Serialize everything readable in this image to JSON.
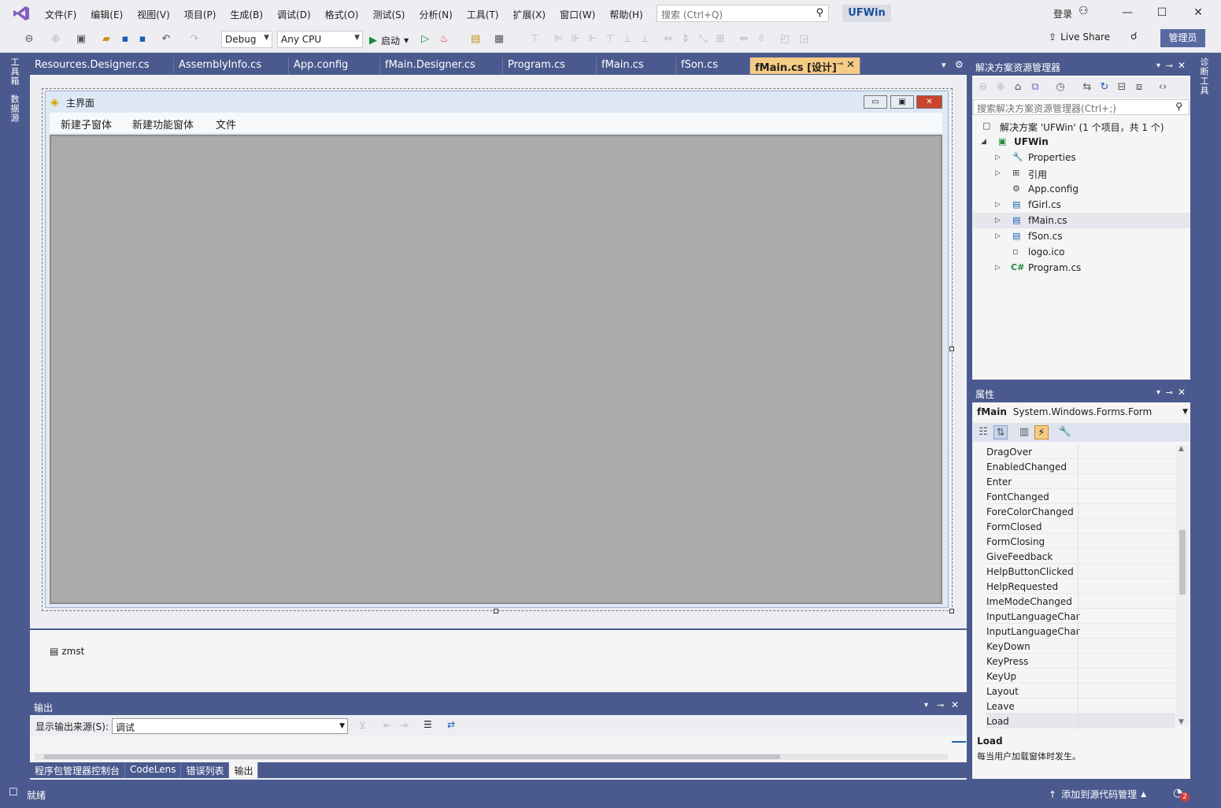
{
  "menu": [
    "文件(F)",
    "编辑(E)",
    "视图(V)",
    "项目(P)",
    "生成(B)",
    "调试(D)",
    "格式(O)",
    "测试(S)",
    "分析(N)",
    "工具(T)",
    "扩展(X)",
    "窗口(W)",
    "帮助(H)"
  ],
  "search": {
    "placeholder": "搜索 (Ctrl+Q)"
  },
  "solution_name": "UFWin",
  "signin": "登录",
  "toolbar": {
    "config": "Debug",
    "platform": "Any CPU",
    "start": "启动"
  },
  "live_share": "Live Share",
  "admin": "管理员",
  "left_tabs": [
    "工具箱",
    "数据源"
  ],
  "right_tabs": [
    "诊断工具"
  ],
  "doc_tabs": [
    "Resources.Designer.cs",
    "AssemblyInfo.cs",
    "App.config",
    "fMain.Designer.cs",
    "Program.cs",
    "fMain.cs",
    "fSon.cs",
    "fMain.cs [设计]"
  ],
  "form": {
    "title": "主界面",
    "menu": [
      "新建子窗体",
      "新建功能窗体",
      "文件"
    ]
  },
  "tray_item": "zmst",
  "output": {
    "title": "输出",
    "source_label": "显示输出来源(S):",
    "source_value": "调试",
    "tabs": [
      "程序包管理器控制台",
      "CodeLens",
      "错误列表",
      "输出"
    ]
  },
  "solexp": {
    "title": "解决方案资源管理器",
    "search_placeholder": "搜索解决方案资源管理器(Ctrl+;)",
    "items": [
      {
        "label": "解决方案 'UFWin' (1 个项目，共 1 个)"
      },
      {
        "label": "UFWin"
      },
      {
        "label": "Properties"
      },
      {
        "label": "引用"
      },
      {
        "label": "App.config"
      },
      {
        "label": "fGirl.cs"
      },
      {
        "label": "fMain.cs"
      },
      {
        "label": "fSon.cs"
      },
      {
        "label": "logo.ico"
      },
      {
        "label": "Program.cs"
      }
    ]
  },
  "props": {
    "title": "属性",
    "object_name": "fMain",
    "object_type": "System.Windows.Forms.Form",
    "events": [
      "DragOver",
      "EnabledChanged",
      "Enter",
      "FontChanged",
      "ForeColorChanged",
      "FormClosed",
      "FormClosing",
      "GiveFeedback",
      "HelpButtonClicked",
      "HelpRequested",
      "ImeModeChanged",
      "InputLanguageChar",
      "InputLanguageChar",
      "KeyDown",
      "KeyPress",
      "KeyUp",
      "Layout",
      "Leave",
      "Load"
    ],
    "desc_title": "Load",
    "desc": "每当用户加载窗体时发生。"
  },
  "status": {
    "ready": "就绪",
    "source_control": "添加到源代码管理",
    "notifications": "2"
  }
}
